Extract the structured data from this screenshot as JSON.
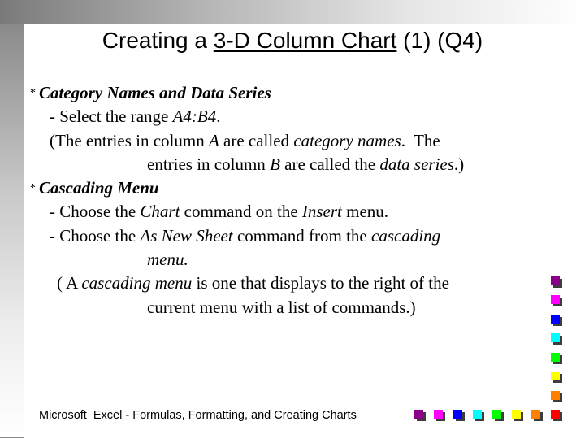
{
  "slide": {
    "title": {
      "prefix": "Creating a ",
      "underlined": "3-D Column Chart",
      "suffix": " (1) (Q4)"
    },
    "sections": [
      {
        "bullet": "*",
        "heading": "Category Names and Data Series",
        "lines": {
          "l1": {
            "a": "- Select the range ",
            "b": "A4:B4",
            "c": "."
          },
          "l2": {
            "a": "(The entries in column ",
            "b": "A",
            "c": " are called ",
            "d": "category names",
            "e": ".  The"
          },
          "l3": {
            "a": "entries in column ",
            "b": "B",
            "c": " are called the ",
            "d": "data series",
            "e": ".)"
          }
        }
      },
      {
        "bullet": "*",
        "heading": "Cascading Menu",
        "lines": {
          "l1": {
            "a": "- Choose the ",
            "b": "Chart",
            "c": " command on the ",
            "d": "Insert",
            "e": " menu."
          },
          "l2": {
            "a": "- Choose the ",
            "b": "As New Sheet",
            "c": " command from the ",
            "d": "cascading"
          },
          "l3": {
            "a": "menu."
          },
          "l4": {
            "a": "( A ",
            "b": "cascading menu",
            "c": " is one that displays to the right of the"
          },
          "l5": {
            "a": "current menu with a list of commands.)"
          }
        }
      }
    ],
    "footer": "Microsoft  Excel - Formulas, Formatting, and Creating Charts"
  },
  "decoration": {
    "square_colors": [
      "#8b008b",
      "#ff00ff",
      "#0000ff",
      "#00ffff",
      "#00ff00",
      "#ffff00",
      "#ff8000",
      "#ff0000"
    ]
  }
}
